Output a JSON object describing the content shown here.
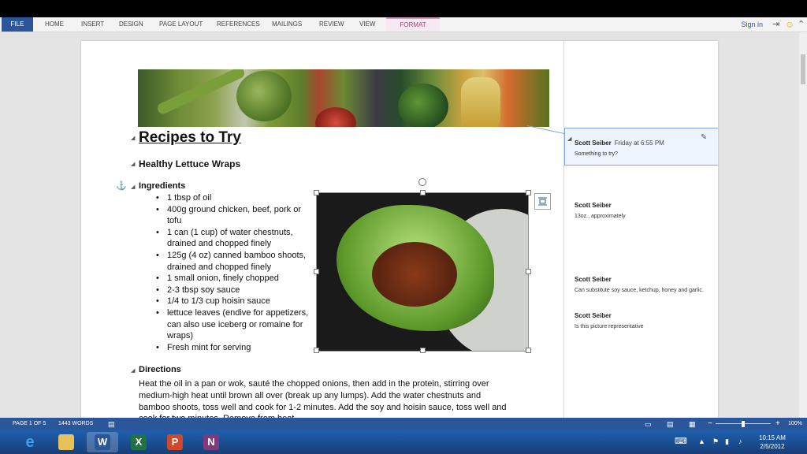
{
  "ribbon": {
    "tabs": [
      "FILE",
      "HOME",
      "INSERT",
      "DESIGN",
      "PAGE LAYOUT",
      "REFERENCES",
      "MAILINGS",
      "REVIEW",
      "VIEW",
      "FORMAT"
    ],
    "sign_in": "Sign in"
  },
  "document": {
    "title": "Recipes to Try",
    "recipe_heading": "Healthy Lettuce Wraps",
    "ingredients_heading": "Ingredients",
    "ingredients": [
      "1 tbsp of oil",
      "400g ground chicken, beef, pork or tofu",
      "1 can (1 cup) of water chestnuts, drained and chopped finely",
      "125g (4 oz) canned bamboo shoots, drained and chopped finely",
      "1 small onion, finely chopped",
      "2-3 tbsp soy sauce",
      "1/4 to 1/3 cup hoisin sauce",
      "lettuce leaves (endive for appetizers, can also use iceberg or romaine for wraps)",
      "Fresh mint for serving"
    ],
    "directions_heading": "Directions",
    "directions_text": "Heat the oil in a pan or wok, sauté the chopped onions, then add in the protein, stirring over medium-high heat until brown all over (break up any lumps). Add the water chestnuts and bamboo shoots, toss well and cook for 1-2 minutes. Add the soy and hoisin sauce, toss well and cook for two minutes. Remove from heat."
  },
  "comments": [
    {
      "author": "Scott Seiber",
      "time": "Friday at 6:55 PM",
      "text": "Something to try?"
    },
    {
      "author": "Scott Seiber",
      "time": "",
      "text": "13oz., approximately"
    },
    {
      "author": "Scott Seiber",
      "time": "",
      "text": "Can substitute soy sauce, ketchup, honey and garlic."
    },
    {
      "author": "Scott Seiber",
      "time": "",
      "text": "Is this picture representative"
    }
  ],
  "status": {
    "page": "PAGE 1 OF 5",
    "words": "1443 WORDS",
    "zoom": "100%"
  },
  "taskbar": {
    "time": "10:15 AM",
    "date": "2/5/2012",
    "apps": [
      "internet-explorer",
      "file-explorer",
      "word",
      "excel",
      "powerpoint",
      "onenote"
    ]
  }
}
